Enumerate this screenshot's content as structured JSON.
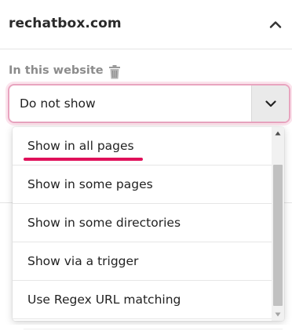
{
  "header": {
    "site": "rechatbox.com",
    "collapse_icon": "chevron-up-icon"
  },
  "section": {
    "label": "In this website",
    "delete_icon": "trash-icon"
  },
  "select": {
    "value": "Do not show",
    "arrow_icon": "chevron-down-icon"
  },
  "dropdown": {
    "options": [
      {
        "label": "Show in all pages"
      },
      {
        "label": "Show in some pages"
      },
      {
        "label": "Show in some directories"
      },
      {
        "label": "Show via a trigger"
      },
      {
        "label": "Use Regex URL matching"
      }
    ],
    "highlight_color": "#e0105a"
  },
  "colors": {
    "focus_border": "#e8a4bf",
    "accent": "#e0105a"
  }
}
